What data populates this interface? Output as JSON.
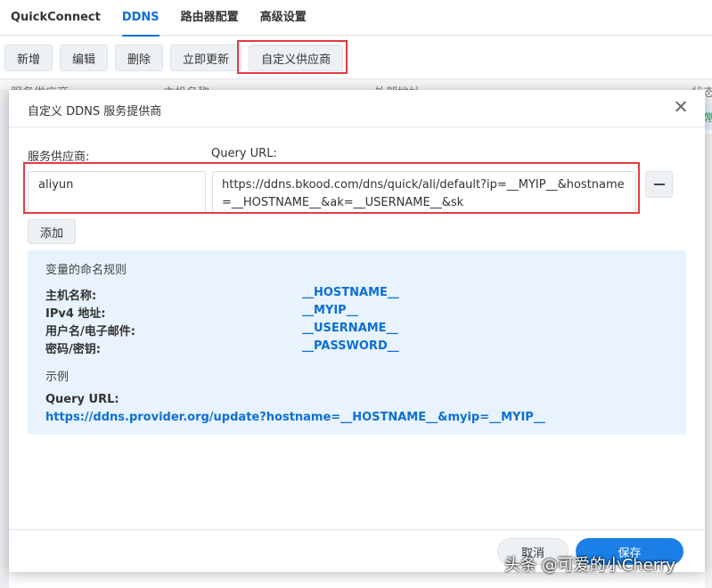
{
  "tabs": [
    {
      "label": "QuickConnect"
    },
    {
      "label": "DDNS"
    },
    {
      "label": "路由器配置"
    },
    {
      "label": "高级设置"
    }
  ],
  "toolbar": {
    "add_label": "新增",
    "edit_label": "编辑",
    "delete_label": "删除",
    "update_label": "立即更新",
    "custom_provider_label": "自定义供应商"
  },
  "grid": {
    "columns": [
      "服务供应商",
      "主机名称",
      "外部地址",
      "状态"
    ],
    "status_fragment": "常"
  },
  "dialog": {
    "title": "自定义 DDNS 服务提供商",
    "provider_label": "服务供应商:",
    "query_url_label": "Query URL:",
    "provider_value": "aliyun",
    "query_url_value": "https://ddns.bkood.com/dns/quick/ali/default?ip=__MYIP__&hostname=__HOSTNAME__&ak=__USERNAME__&sk",
    "add_label": "添加",
    "info": {
      "title": "变量的命名规则",
      "variables": [
        {
          "key": "主机名称:",
          "value": "__HOSTNAME__"
        },
        {
          "key": "IPv4 地址:",
          "value": "__MYIP__"
        },
        {
          "key": "用户名/电子邮件:",
          "value": "__USERNAME__"
        },
        {
          "key": "密码/密钥:",
          "value": "__PASSWORD__"
        }
      ],
      "example_title": "示例",
      "example_label": "Query URL:",
      "example_url": "https://ddns.provider.org/update?hostname=__HOSTNAME__&myip=__MYIP__"
    },
    "cancel_label": "取消",
    "save_label": "保存"
  },
  "watermark": "头条 @可爱的小Cherry",
  "colors": {
    "accent": "#0d6fd6",
    "primary_button": "#1a7fe6",
    "highlight_box": "#e53a40",
    "info_background": "#e8f3fd"
  }
}
